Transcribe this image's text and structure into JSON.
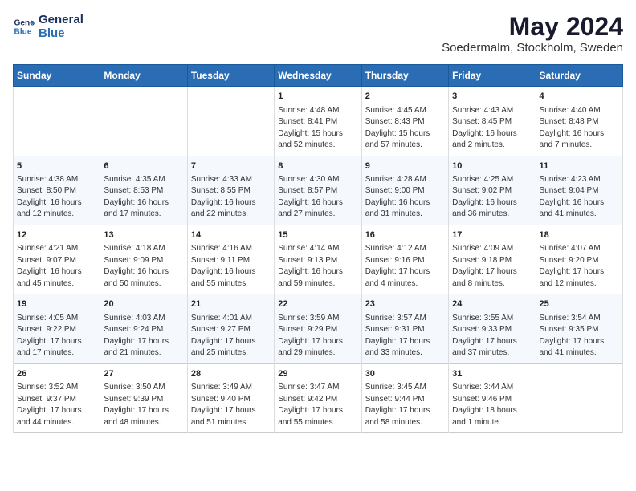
{
  "header": {
    "logo_line1": "General",
    "logo_line2": "Blue",
    "month_year": "May 2024",
    "location": "Soedermalm, Stockholm, Sweden"
  },
  "weekdays": [
    "Sunday",
    "Monday",
    "Tuesday",
    "Wednesday",
    "Thursday",
    "Friday",
    "Saturday"
  ],
  "weeks": [
    [
      {
        "day": "",
        "info": ""
      },
      {
        "day": "",
        "info": ""
      },
      {
        "day": "",
        "info": ""
      },
      {
        "day": "1",
        "info": "Sunrise: 4:48 AM\nSunset: 8:41 PM\nDaylight: 15 hours and 52 minutes."
      },
      {
        "day": "2",
        "info": "Sunrise: 4:45 AM\nSunset: 8:43 PM\nDaylight: 15 hours and 57 minutes."
      },
      {
        "day": "3",
        "info": "Sunrise: 4:43 AM\nSunset: 8:45 PM\nDaylight: 16 hours and 2 minutes."
      },
      {
        "day": "4",
        "info": "Sunrise: 4:40 AM\nSunset: 8:48 PM\nDaylight: 16 hours and 7 minutes."
      }
    ],
    [
      {
        "day": "5",
        "info": "Sunrise: 4:38 AM\nSunset: 8:50 PM\nDaylight: 16 hours and 12 minutes."
      },
      {
        "day": "6",
        "info": "Sunrise: 4:35 AM\nSunset: 8:53 PM\nDaylight: 16 hours and 17 minutes."
      },
      {
        "day": "7",
        "info": "Sunrise: 4:33 AM\nSunset: 8:55 PM\nDaylight: 16 hours and 22 minutes."
      },
      {
        "day": "8",
        "info": "Sunrise: 4:30 AM\nSunset: 8:57 PM\nDaylight: 16 hours and 27 minutes."
      },
      {
        "day": "9",
        "info": "Sunrise: 4:28 AM\nSunset: 9:00 PM\nDaylight: 16 hours and 31 minutes."
      },
      {
        "day": "10",
        "info": "Sunrise: 4:25 AM\nSunset: 9:02 PM\nDaylight: 16 hours and 36 minutes."
      },
      {
        "day": "11",
        "info": "Sunrise: 4:23 AM\nSunset: 9:04 PM\nDaylight: 16 hours and 41 minutes."
      }
    ],
    [
      {
        "day": "12",
        "info": "Sunrise: 4:21 AM\nSunset: 9:07 PM\nDaylight: 16 hours and 45 minutes."
      },
      {
        "day": "13",
        "info": "Sunrise: 4:18 AM\nSunset: 9:09 PM\nDaylight: 16 hours and 50 minutes."
      },
      {
        "day": "14",
        "info": "Sunrise: 4:16 AM\nSunset: 9:11 PM\nDaylight: 16 hours and 55 minutes."
      },
      {
        "day": "15",
        "info": "Sunrise: 4:14 AM\nSunset: 9:13 PM\nDaylight: 16 hours and 59 minutes."
      },
      {
        "day": "16",
        "info": "Sunrise: 4:12 AM\nSunset: 9:16 PM\nDaylight: 17 hours and 4 minutes."
      },
      {
        "day": "17",
        "info": "Sunrise: 4:09 AM\nSunset: 9:18 PM\nDaylight: 17 hours and 8 minutes."
      },
      {
        "day": "18",
        "info": "Sunrise: 4:07 AM\nSunset: 9:20 PM\nDaylight: 17 hours and 12 minutes."
      }
    ],
    [
      {
        "day": "19",
        "info": "Sunrise: 4:05 AM\nSunset: 9:22 PM\nDaylight: 17 hours and 17 minutes."
      },
      {
        "day": "20",
        "info": "Sunrise: 4:03 AM\nSunset: 9:24 PM\nDaylight: 17 hours and 21 minutes."
      },
      {
        "day": "21",
        "info": "Sunrise: 4:01 AM\nSunset: 9:27 PM\nDaylight: 17 hours and 25 minutes."
      },
      {
        "day": "22",
        "info": "Sunrise: 3:59 AM\nSunset: 9:29 PM\nDaylight: 17 hours and 29 minutes."
      },
      {
        "day": "23",
        "info": "Sunrise: 3:57 AM\nSunset: 9:31 PM\nDaylight: 17 hours and 33 minutes."
      },
      {
        "day": "24",
        "info": "Sunrise: 3:55 AM\nSunset: 9:33 PM\nDaylight: 17 hours and 37 minutes."
      },
      {
        "day": "25",
        "info": "Sunrise: 3:54 AM\nSunset: 9:35 PM\nDaylight: 17 hours and 41 minutes."
      }
    ],
    [
      {
        "day": "26",
        "info": "Sunrise: 3:52 AM\nSunset: 9:37 PM\nDaylight: 17 hours and 44 minutes."
      },
      {
        "day": "27",
        "info": "Sunrise: 3:50 AM\nSunset: 9:39 PM\nDaylight: 17 hours and 48 minutes."
      },
      {
        "day": "28",
        "info": "Sunrise: 3:49 AM\nSunset: 9:40 PM\nDaylight: 17 hours and 51 minutes."
      },
      {
        "day": "29",
        "info": "Sunrise: 3:47 AM\nSunset: 9:42 PM\nDaylight: 17 hours and 55 minutes."
      },
      {
        "day": "30",
        "info": "Sunrise: 3:45 AM\nSunset: 9:44 PM\nDaylight: 17 hours and 58 minutes."
      },
      {
        "day": "31",
        "info": "Sunrise: 3:44 AM\nSunset: 9:46 PM\nDaylight: 18 hours and 1 minute."
      },
      {
        "day": "",
        "info": ""
      }
    ]
  ]
}
